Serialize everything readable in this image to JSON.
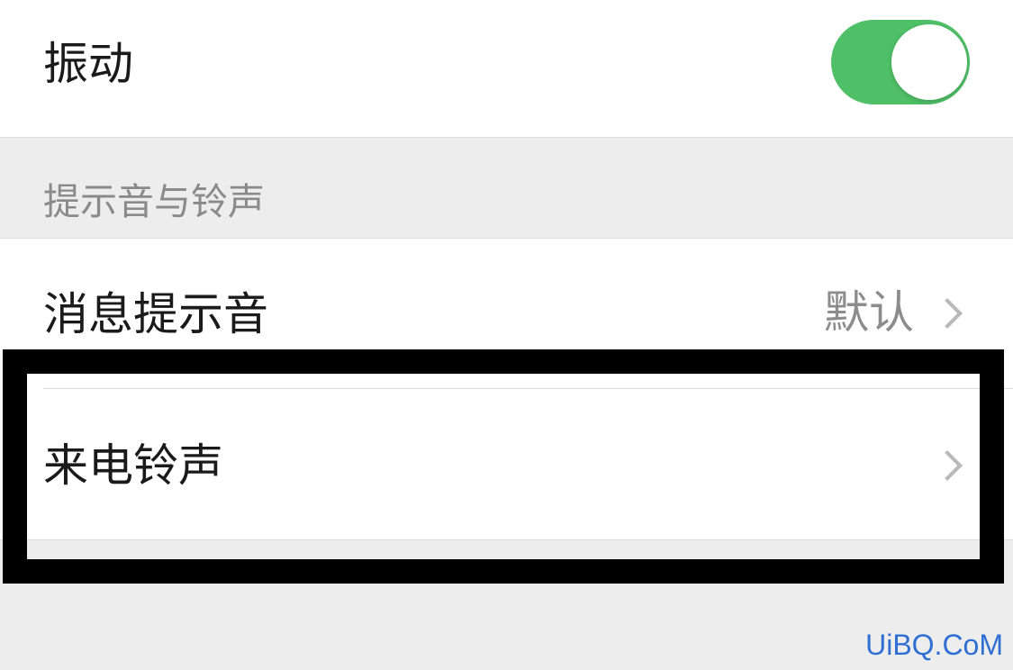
{
  "vibration": {
    "label": "振动",
    "toggle_on": true,
    "toggle_color": "#4fc067"
  },
  "sound_section": {
    "header": "提示音与铃声",
    "message_tone": {
      "label": "消息提示音",
      "value": "默认",
      "icon": "chevron-right-icon"
    },
    "ringtone": {
      "label": "来电铃声",
      "icon": "chevron-right-icon"
    }
  },
  "annotation": {
    "highlight_color": "#000000"
  },
  "watermark": {
    "text": "UiBQ.CoM",
    "color": "#2f6fd3"
  }
}
